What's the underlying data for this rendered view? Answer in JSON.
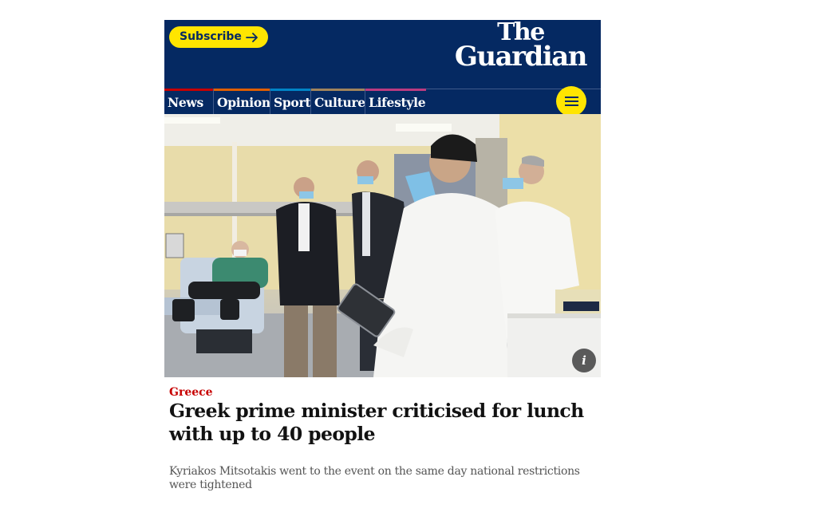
{
  "header": {
    "subscribe_label": "Subscribe",
    "logo_line1": "The",
    "logo_line2": "Guardian",
    "brand_color": "#052962",
    "accent_color": "#ffe500"
  },
  "nav": {
    "items": [
      {
        "label": "News",
        "color": "#c70000"
      },
      {
        "label": "Opinion",
        "color": "#e05e00"
      },
      {
        "label": "Sport",
        "color": "#0084c6"
      },
      {
        "label": "Culture",
        "color": "#a1845c"
      },
      {
        "label": "Lifestyle",
        "color": "#bb3b80"
      }
    ],
    "menu_icon": "hamburger-menu-icon"
  },
  "article": {
    "section": "Greece",
    "headline": "Greek prime minister criticised for lunch with up to 40 people",
    "standfirst": "Kyriakos Mitsotakis went to the event on the same day national restrictions were tightened",
    "image_info_label": "i"
  }
}
